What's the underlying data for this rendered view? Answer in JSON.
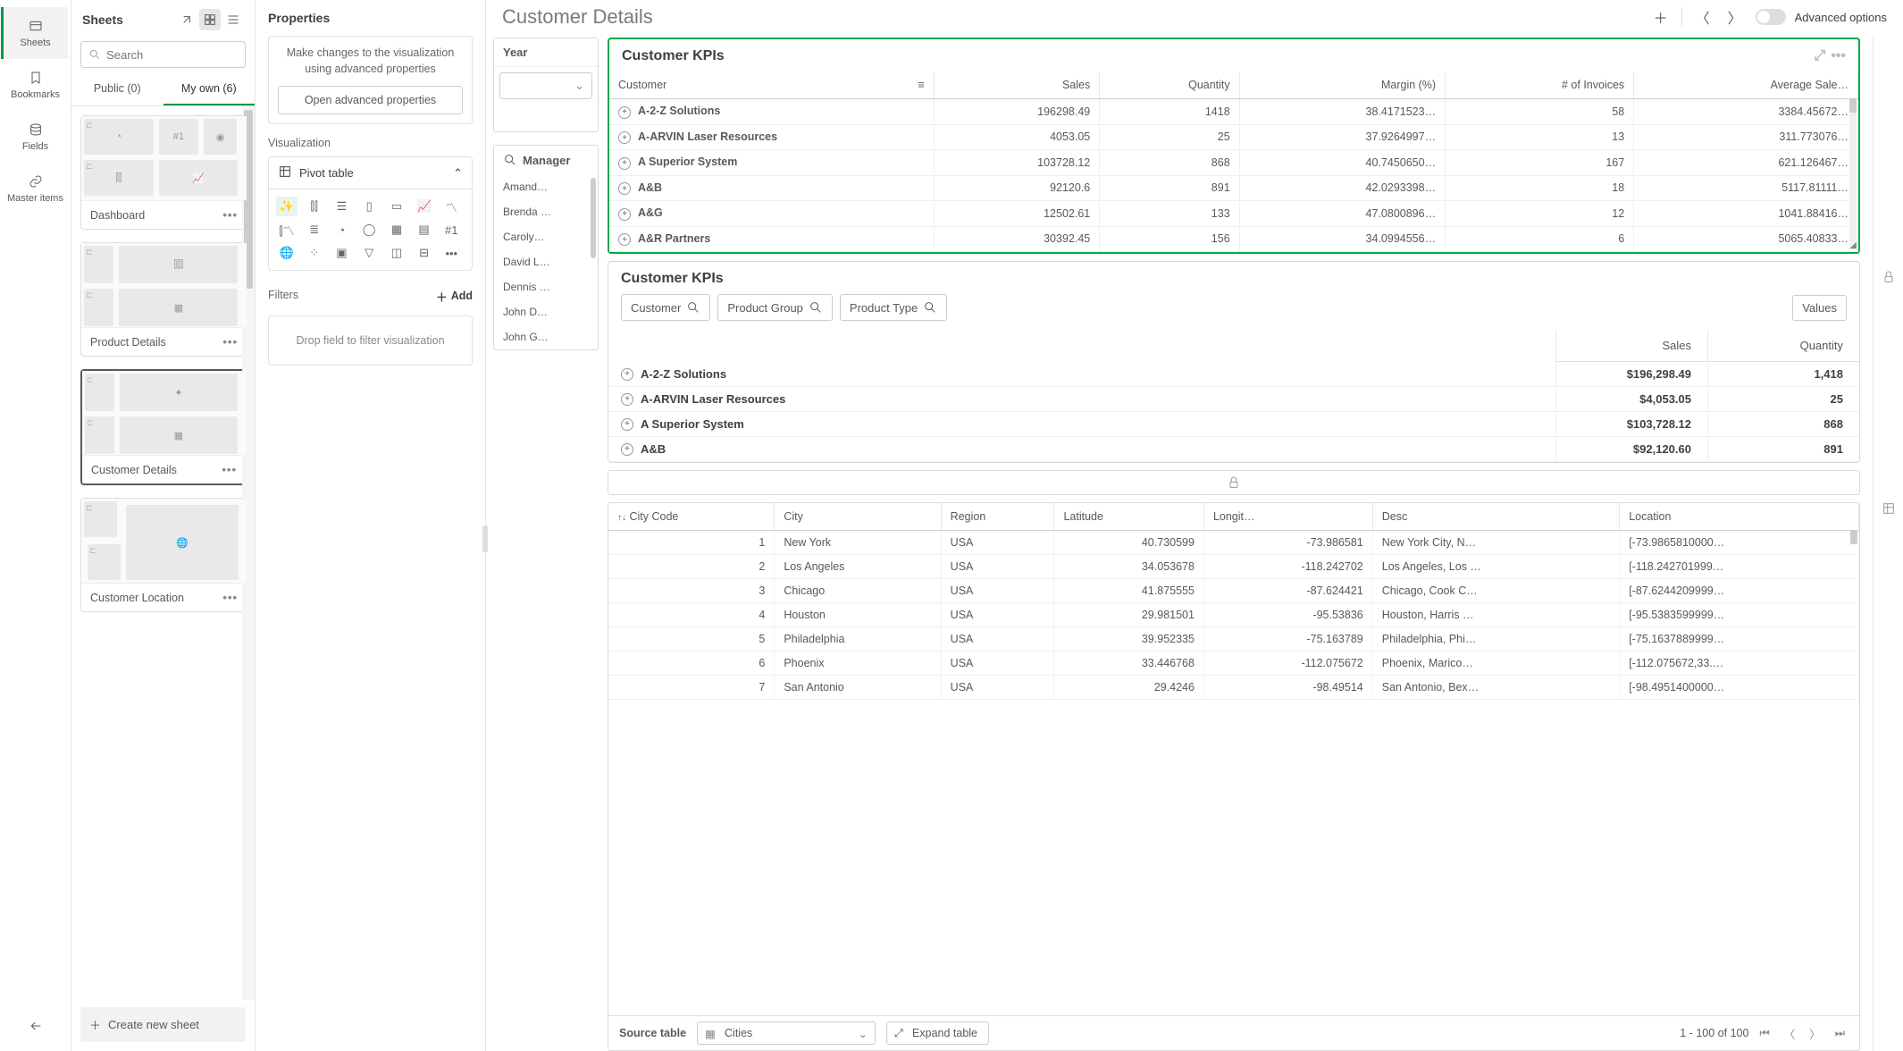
{
  "rail": {
    "sheets": "Sheets",
    "bookmarks": "Bookmarks",
    "fields": "Fields",
    "master": "Master items"
  },
  "sheetsPanel": {
    "title": "Sheets",
    "searchPlaceholder": "Search",
    "tabPublic": "Public (0)",
    "tabMyOwn": "My own (6)",
    "cards": [
      {
        "name": "Dashboard"
      },
      {
        "name": "Product Details"
      },
      {
        "name": "Customer Details"
      },
      {
        "name": "Customer Location"
      }
    ],
    "createNew": "Create new sheet"
  },
  "props": {
    "title": "Properties",
    "help": "Make changes to the visualization using advanced properties",
    "openAdvanced": "Open advanced properties",
    "vizLabel": "Visualization",
    "vizType": "Pivot table",
    "filtersLabel": "Filters",
    "addLabel": "Add",
    "dropHint": "Drop field to filter visualization"
  },
  "header": {
    "pageTitle": "Customer Details",
    "advOptions": "Advanced options"
  },
  "yearFilter": {
    "title": "Year"
  },
  "managerFilter": {
    "title": "Manager",
    "items": [
      "Amand…",
      "Brenda …",
      "Caroly…",
      "David L…",
      "Dennis …",
      "John D…",
      "John G…"
    ]
  },
  "kpi1": {
    "title": "Customer KPIs",
    "cols": [
      "Customer",
      "Sales",
      "Quantity",
      "Margin (%)",
      "# of Invoices",
      "Average Sale…"
    ],
    "rows": [
      [
        "A-2-Z Solutions",
        "196298.49",
        "1418",
        "38.4171523…",
        "58",
        "3384.45672…"
      ],
      [
        "A-ARVIN Laser Resources",
        "4053.05",
        "25",
        "37.9264997…",
        "13",
        "311.773076…"
      ],
      [
        "A Superior System",
        "103728.12",
        "868",
        "40.7450650…",
        "167",
        "621.126467…"
      ],
      [
        "A&B",
        "92120.6",
        "891",
        "42.0293398…",
        "18",
        "5117.81111…"
      ],
      [
        "A&G",
        "12502.61",
        "133",
        "47.0800896…",
        "12",
        "1041.88416…"
      ],
      [
        "A&R Partners",
        "30392.45",
        "156",
        "34.0994556…",
        "6",
        "5065.40833…"
      ]
    ]
  },
  "kpi2": {
    "title": "Customer KPIs",
    "chips": {
      "customer": "Customer",
      "productGroup": "Product Group",
      "productType": "Product Type",
      "values": "Values"
    },
    "headers": [
      "Sales",
      "Quantity"
    ],
    "rows": [
      [
        "A-2-Z Solutions",
        "$196,298.49",
        "1,418"
      ],
      [
        "A-ARVIN Laser Resources",
        "$4,053.05",
        "25"
      ],
      [
        "A Superior System",
        "$103,728.12",
        "868"
      ],
      [
        "A&B",
        "$92,120.60",
        "891"
      ]
    ]
  },
  "dataTable": {
    "cols": [
      "City Code",
      "City",
      "Region",
      "Latitude",
      "Longit…",
      "Desc",
      "Location"
    ],
    "rows": [
      [
        "1",
        "New York",
        "USA",
        "40.730599",
        "-73.986581",
        "New York City, N…",
        "[-73.9865810000…"
      ],
      [
        "2",
        "Los Angeles",
        "USA",
        "34.053678",
        "-118.242702",
        "Los Angeles, Los …",
        "[-118.242701999…"
      ],
      [
        "3",
        "Chicago",
        "USA",
        "41.875555",
        "-87.624421",
        "Chicago, Cook C…",
        "[-87.6244209999…"
      ],
      [
        "4",
        "Houston",
        "USA",
        "29.981501",
        "-95.53836",
        "Houston, Harris …",
        "[-95.5383599999…"
      ],
      [
        "5",
        "Philadelphia",
        "USA",
        "39.952335",
        "-75.163789",
        "Philadelphia, Phi…",
        "[-75.1637889999…"
      ],
      [
        "6",
        "Phoenix",
        "USA",
        "33.446768",
        "-112.075672",
        "Phoenix, Marico…",
        "[-112.075672,33.…"
      ],
      [
        "7",
        "San Antonio",
        "USA",
        "29.4246",
        "-98.49514",
        "San Antonio, Bex…",
        "[-98.4951400000…"
      ]
    ],
    "sourceLabel": "Source table",
    "sourceValue": "Cities",
    "expandLabel": "Expand table",
    "pageInfo": "1 - 100 of 100"
  }
}
